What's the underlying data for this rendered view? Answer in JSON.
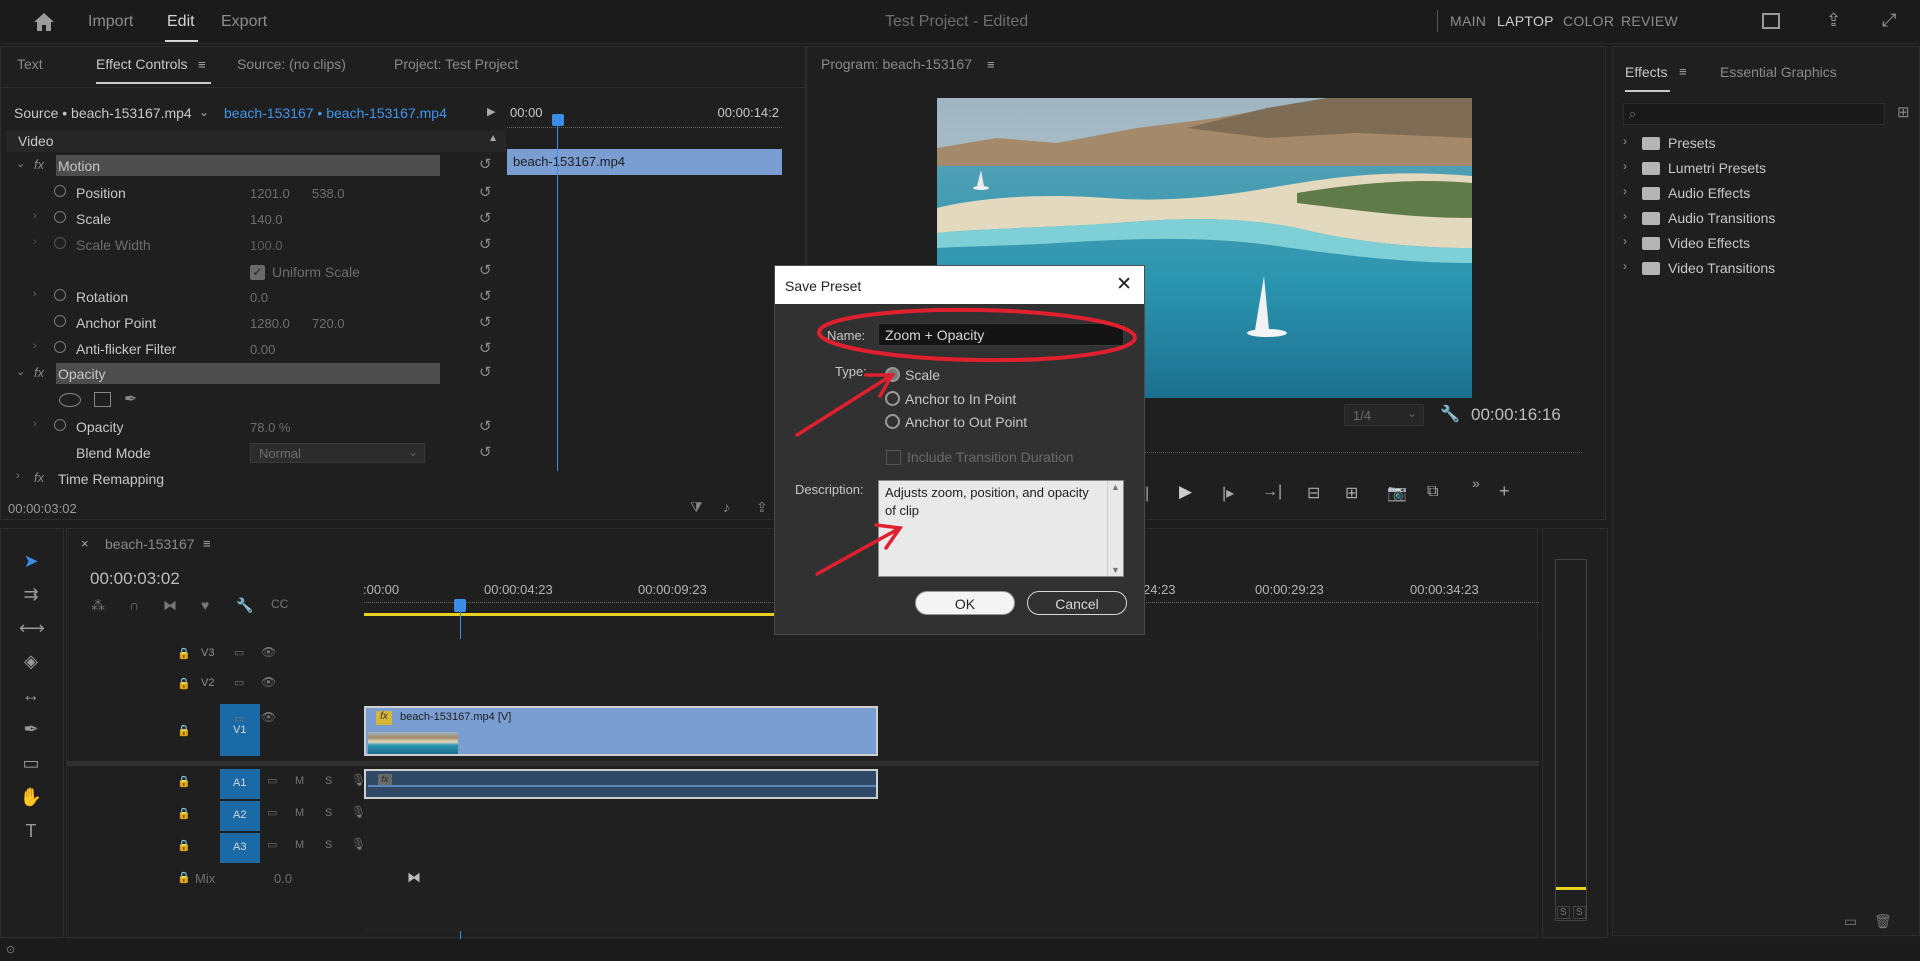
{
  "topbar": {
    "menu": [
      "Import",
      "Edit",
      "Export"
    ],
    "title": "Test Project",
    "title_suffix": " - Edited",
    "workspaces": [
      "MAIN",
      "LAPTOP",
      "COLOR",
      "REVIEW"
    ]
  },
  "left_panel": {
    "tabs": [
      "Text",
      "Effect Controls",
      "Source: (no clips)",
      "Project: Test Project"
    ],
    "source_label": "Source • beach-153167.mp4",
    "clip_label": "beach-153167 • beach-153167.mp4",
    "section": "Video",
    "mini_timeline": {
      "start": "00:00",
      "end": "00:00:14:2",
      "clip": "beach-153167.mp4"
    },
    "motion": {
      "name": "Motion",
      "rows": [
        {
          "label": "Position",
          "v1": "1201.0",
          "v2": "538.0"
        },
        {
          "label": "Scale",
          "v1": "140.0",
          "v2": ""
        },
        {
          "label": "Scale Width",
          "v1": "100.0",
          "v2": ""
        },
        {
          "label": "Uniform Scale",
          "v1": "",
          "v2": ""
        },
        {
          "label": "Rotation",
          "v1": "0.0",
          "v2": ""
        },
        {
          "label": "Anchor Point",
          "v1": "1280.0",
          "v2": "720.0"
        },
        {
          "label": "Anti-flicker Filter",
          "v1": "0.00",
          "v2": ""
        }
      ]
    },
    "opacity": {
      "name": "Opacity",
      "opacity_label": "Opacity",
      "opacity_value": "78.0 %",
      "blend_label": "Blend Mode",
      "blend_value": "Normal"
    },
    "time_remap": "Time Remapping",
    "timecode": "00:00:03:02"
  },
  "program": {
    "title": "Program: beach-153167",
    "fraction": "1/4",
    "timecode": "00:00:16:16"
  },
  "effects_panel": {
    "tabs": [
      "Effects",
      "Essential Graphics"
    ],
    "items": [
      "Presets",
      "Lumetri Presets",
      "Audio Effects",
      "Audio Transitions",
      "Video Effects",
      "Video Transitions"
    ]
  },
  "timeline": {
    "sequence": "beach-153167",
    "timecode": "00:00:03:02",
    "ticks": [
      ":00:00",
      "00:00:04:23",
      "00:00:09:23",
      "24:23",
      "00:00:29:23",
      "00:00:34:23"
    ],
    "tracks_video": [
      "V3",
      "V2",
      "V1"
    ],
    "tracks_audio": [
      "A1",
      "A2",
      "A3"
    ],
    "mix_label": "Mix",
    "mix_value": "0.0",
    "clip_label": "beach-153167.mp4 [V]",
    "meter_labels": [
      "S",
      "S"
    ]
  },
  "dialog": {
    "title": "Save Preset",
    "name_label": "Name:",
    "name_value": "Zoom + Opacity",
    "type_label": "Type:",
    "options": [
      "Scale",
      "Anchor to In Point",
      "Anchor to Out Point"
    ],
    "selected": "Scale",
    "include_label": "Include Transition Duration",
    "desc_label": "Description:",
    "desc_value": "Adjusts zoom, position, and opacity of clip",
    "ok": "OK",
    "cancel": "Cancel"
  },
  "colors": {
    "accent": "#2d8ceb",
    "clip": "#7b9ed2",
    "annotation": "#e0202e",
    "track_blue": "#1a6aa8"
  }
}
